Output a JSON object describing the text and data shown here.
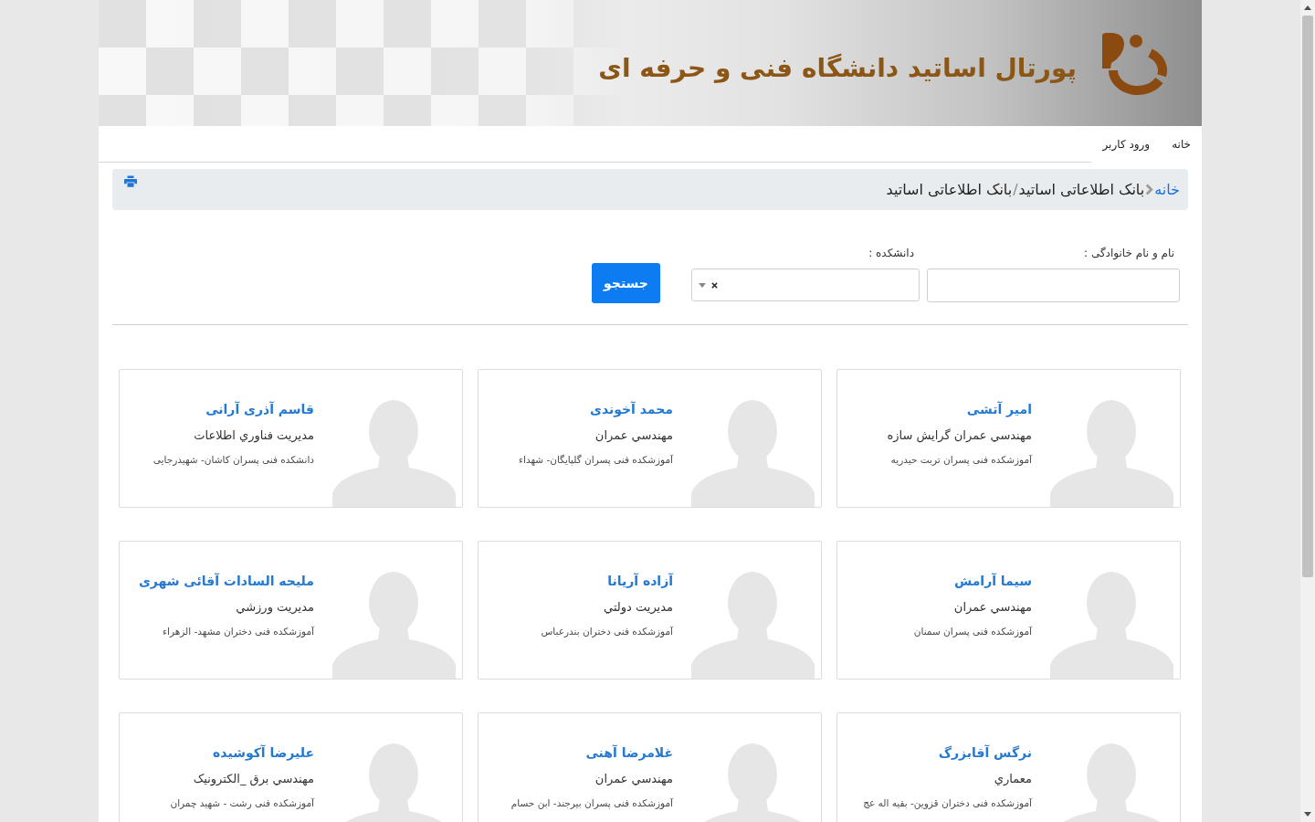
{
  "banner": {
    "title": "پورتال اساتید دانشگاه فنی و حرفه ای"
  },
  "nav": {
    "items": [
      {
        "label": "خانه"
      },
      {
        "label": "ورود کاربر"
      }
    ]
  },
  "breadcrumb": {
    "items": [
      {
        "kind": "link",
        "label": "خانه"
      },
      {
        "kind": "chevron"
      },
      {
        "kind": "text",
        "label": "بانک اطلاعاتی اساتید"
      },
      {
        "kind": "slash",
        "label": "/"
      },
      {
        "kind": "text",
        "label": "بانک اطلاعاتی اساتید"
      }
    ]
  },
  "search_form": {
    "fields": [
      {
        "kind": "text",
        "label": "نام و نام خانوادگی :"
      },
      {
        "kind": "select",
        "label": "دانشکده :",
        "clearable": true
      }
    ],
    "button": "جستجو"
  },
  "professors": [
    {
      "name": "امیر آتشی",
      "degree": "مهندسي عمران گرايش سازه",
      "institute": "آموزشکده فنی پسران تربت حیدریه"
    },
    {
      "name": "محمد آخوندی",
      "degree": "مهندسي عمران",
      "institute": "آموزشکده فنی پسران گلپایگان- شهداء"
    },
    {
      "name": "قاسم آذری آرانی",
      "degree": "مديريت فناوري اطلاعات",
      "institute": "دانشکده فنی پسران کاشان- شهیدرجایی"
    },
    {
      "name": "سیما آرامش",
      "degree": "مهندسي عمران",
      "institute": "آموزشکده فنی پسران سمنان"
    },
    {
      "name": "آزاده آریانا",
      "degree": "مديريت دولتي",
      "institute": "آموزشکده فنی دختران بندرعباس"
    },
    {
      "name": "ملیحه السادات آقائی شهری",
      "degree": "مديريت ورزشي",
      "institute": "آموزشکده فنی دختران مشهد- الزهراء"
    },
    {
      "name": "نرگس آقابزرگ",
      "degree": "معماري",
      "institute": "آموزشکده فنی دختران قزوین- بقیه اله عج"
    },
    {
      "name": "غلامرضا آهنی",
      "degree": "مهندسي عمران",
      "institute": "آموزشکده فنی پسران بیرجند- ابن حسام"
    },
    {
      "name": "علیرضا آکوشیده",
      "degree": "مهندسي برق _الکترونيک",
      "institute": "آموزشکده فنی رشت - شهید چمران"
    }
  ]
}
